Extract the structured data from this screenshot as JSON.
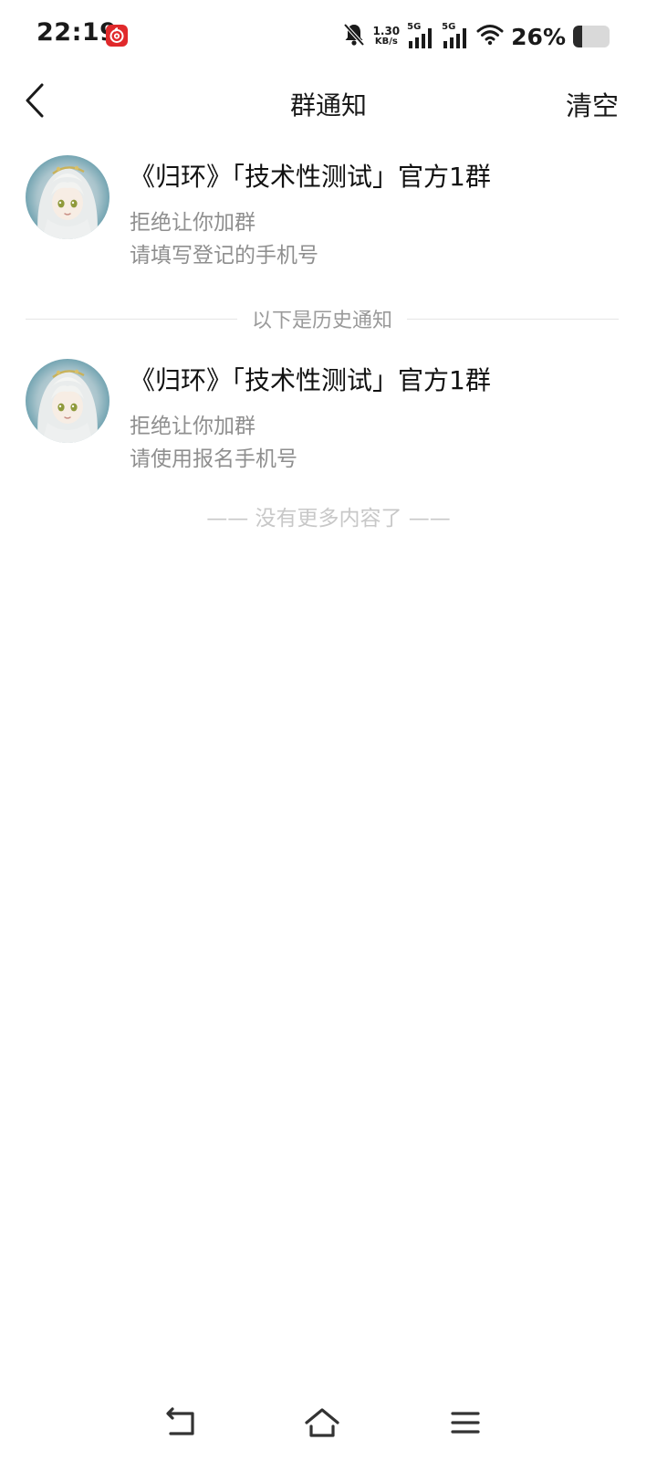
{
  "status_bar": {
    "time": "22:19",
    "net_speed_value": "1.30",
    "net_speed_unit": "KB/s",
    "sim1_label": "5G",
    "sim2_label": "5G",
    "battery_text": "26%",
    "battery_level": 0.26,
    "app_icon": "netease-music-icon",
    "icons": [
      "bell-muted-icon",
      "signal-icon",
      "signal-icon",
      "wifi-icon",
      "battery-icon"
    ]
  },
  "header": {
    "title": "群通知",
    "clear_label": "清空",
    "back_icon": "chevron-left-icon"
  },
  "notices": [
    {
      "group_name": "《归环》「技术性测试」官方1群",
      "status": "拒绝让你加群",
      "message": "请填写登记的手机号"
    },
    {
      "group_name": "《归环》「技术性测试」官方1群",
      "status": "拒绝让你加群",
      "message": "请使用报名手机号"
    }
  ],
  "history_divider": "以下是历史通知",
  "end_text": "—— 没有更多内容了 ——",
  "nav_bar": {
    "icons": [
      "back-nav-icon",
      "home-icon",
      "menu-icon"
    ]
  },
  "colors": {
    "app_badge": "#e0292b",
    "secondary_text": "#8f8f8f",
    "end_text": "#c8c8c8"
  }
}
